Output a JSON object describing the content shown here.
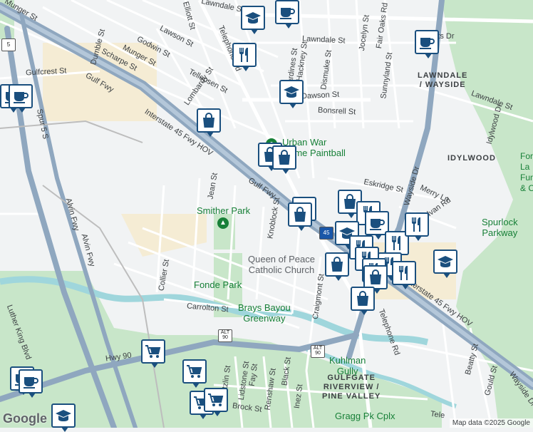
{
  "colors": {
    "land": "#f1f3f4",
    "park": "#c8e6c9",
    "water": "#9fd6dc",
    "highway": "#8fa7bf",
    "road": "#ffffff",
    "pin_border": "#1a4f7e"
  },
  "streets": [
    {
      "name": "Munger St"
    },
    {
      "name": "Lawndale St"
    },
    {
      "name": "Elliott St"
    },
    {
      "name": "Lawson St"
    },
    {
      "name": "Godwin St"
    },
    {
      "name": "Munger St"
    },
    {
      "name": "Dumble St"
    },
    {
      "name": "Scharpe St"
    },
    {
      "name": "Lombardy St"
    },
    {
      "name": "Telephone Rd"
    },
    {
      "name": "Tellepsen St"
    },
    {
      "name": "Gulfcrest St"
    },
    {
      "name": "Gulf Fwy"
    },
    {
      "name": "Interstate 45 Fwy HOV"
    },
    {
      "name": "Spur 5 S"
    },
    {
      "name": "Jean St"
    },
    {
      "name": "Gulf Fwy"
    },
    {
      "name": "Knoblock St"
    },
    {
      "name": "Alvin Fwy"
    },
    {
      "name": "Alvin Fwy"
    },
    {
      "name": "Collier St"
    },
    {
      "name": "Carrolton St"
    },
    {
      "name": "Hwy 90"
    },
    {
      "name": "Lawndale St"
    },
    {
      "name": "Jocelyn St"
    },
    {
      "name": "Fair Oaks Rd"
    },
    {
      "name": "Des Jardines St"
    },
    {
      "name": "Hackney St"
    },
    {
      "name": "Dismuke St"
    },
    {
      "name": "Dawson St"
    },
    {
      "name": "Bonsrell St"
    },
    {
      "name": "Sunnyland St"
    },
    {
      "name": "Eskridge St"
    },
    {
      "name": "Merry Ln"
    },
    {
      "name": "Sylvan Rd"
    },
    {
      "name": "Wayside Dr"
    },
    {
      "name": "Lawndale St"
    },
    {
      "name": "Idylwood Dr"
    },
    {
      "name": "Craigmont St"
    },
    {
      "name": "Telephone Rd"
    },
    {
      "name": "Interstate 45 Fwy HOV"
    },
    {
      "name": "Pitzlin St"
    },
    {
      "name": "Lidstone St"
    },
    {
      "name": "Fay St"
    },
    {
      "name": "Renshaw St"
    },
    {
      "name": "Black St"
    },
    {
      "name": "Inez St"
    },
    {
      "name": "Brock St"
    },
    {
      "name": "Beatty St"
    },
    {
      "name": "Gould St"
    },
    {
      "name": "Wayside Dr"
    },
    {
      "name": "Luther King Blvd"
    },
    {
      "name": "Counts Dr"
    },
    {
      "name": "Tele"
    }
  ],
  "neighborhoods": [
    "LAWNDALE\n/ WAYSIDE",
    "IDYLWOOD",
    "GULFGATE\nRIVERVIEW /\nPINE VALLEY"
  ],
  "pois": [
    "Urban War\nGame Paintball",
    "Smither Park",
    "Fonde Park",
    "Brays Bayou\nGreenway",
    "Queen of Peace\nCatholic Church",
    "Spurlock\nParkway",
    "Kuhlman\nGully",
    "Gragg Pk Cplx",
    "Forest\nLa\nFun\n& Cu"
  ],
  "shields": [
    "ALT\n90",
    "ALT\n90",
    "45",
    "5"
  ],
  "map_footer": {
    "logo": "Google",
    "attribution": "Map data ©2025 Google"
  }
}
